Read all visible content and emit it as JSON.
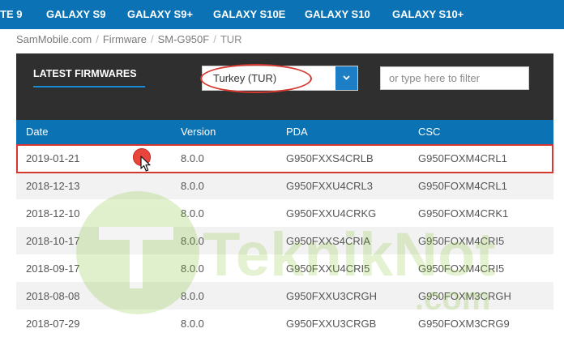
{
  "nav": {
    "items": [
      {
        "label": "TE 9"
      },
      {
        "label": "GALAXY S9"
      },
      {
        "label": "GALAXY S9+"
      },
      {
        "label": "GALAXY S10E"
      },
      {
        "label": "GALAXY S10"
      },
      {
        "label": "GALAXY S10+"
      }
    ]
  },
  "breadcrumb": {
    "items": [
      "SamMobile.com",
      "Firmware",
      "SM-G950F",
      "TUR"
    ],
    "separator": "/"
  },
  "panel": {
    "title": "LATEST FIRMWARES",
    "region_select": {
      "value": "Turkey (TUR)"
    },
    "filter": {
      "placeholder": "or type here to filter"
    }
  },
  "table": {
    "headers": [
      "Date",
      "Version",
      "PDA",
      "CSC"
    ],
    "rows": [
      [
        "2019-01-21",
        "8.0.0",
        "G950FXXS4CRLB",
        "G950FOXM4CRL1"
      ],
      [
        "2018-12-13",
        "8.0.0",
        "G950FXXU4CRL3",
        "G950FOXM4CRL1"
      ],
      [
        "2018-12-10",
        "8.0.0",
        "G950FXXU4CRKG",
        "G950FOXM4CRK1"
      ],
      [
        "2018-10-17",
        "8.0.0",
        "G950FXXS4CRIA",
        "G950FOXM4CRI5"
      ],
      [
        "2018-09-17",
        "8.0.0",
        "G950FXXU4CRI5",
        "G950FOXM4CRI5"
      ],
      [
        "2018-08-08",
        "8.0.0",
        "G950FXXU3CRGH",
        "G950FOXM3CRGH"
      ],
      [
        "2018-07-29",
        "8.0.0",
        "G950FXXU3CRGB",
        "G950FOXM3CRG9"
      ]
    ]
  },
  "watermark": {
    "brand": "TeknikNot",
    "suffix": ".com"
  },
  "colors": {
    "nav_bg": "#0b73b5",
    "panel_bg": "#2f2f2f",
    "table_header_bg": "#0b72b4",
    "accent": "#1a8ad4",
    "highlight": "#d4382f"
  }
}
